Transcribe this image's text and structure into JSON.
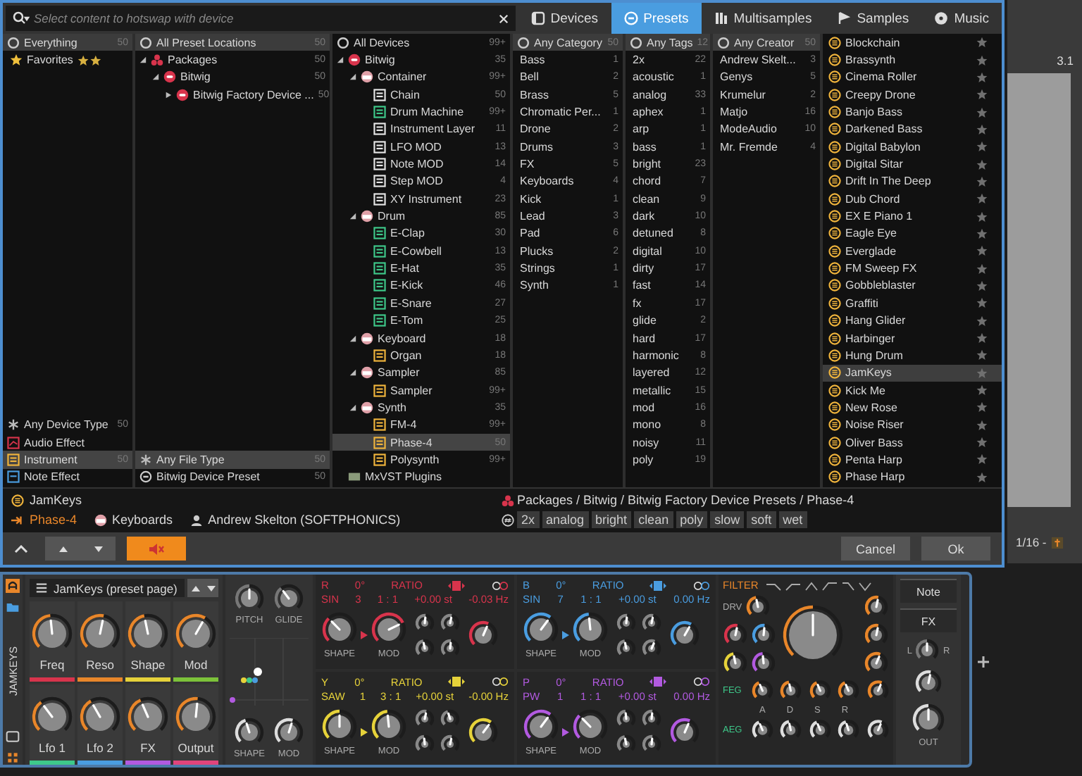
{
  "search": {
    "placeholder": "Select content to hotswap with device"
  },
  "tabs": [
    {
      "label": "Devices",
      "kind": "devices",
      "selected": false
    },
    {
      "label": "Presets",
      "kind": "presets",
      "selected": true
    },
    {
      "label": "Multisamples",
      "kind": "multisamples",
      "selected": false
    },
    {
      "label": "Samples",
      "kind": "samples",
      "selected": false
    },
    {
      "label": "Music",
      "kind": "music",
      "selected": false
    }
  ],
  "sources": {
    "header": {
      "label": "Everything",
      "count": "50",
      "selected": true
    },
    "favorites": {
      "label": "Favorites"
    },
    "device_types": [
      {
        "label": "Any Device Type",
        "count": "50",
        "kind": "any",
        "selected": false
      },
      {
        "label": "Audio Effect",
        "kind": "audio",
        "selected": false
      },
      {
        "label": "Instrument",
        "count": "50",
        "kind": "instrument",
        "selected": true
      },
      {
        "label": "Note Effect",
        "kind": "note",
        "selected": false
      }
    ]
  },
  "locations": {
    "header": {
      "label": "All Preset Locations",
      "count": "50",
      "selected": true
    },
    "tree": [
      {
        "label": "Packages",
        "count": "50",
        "kind": "package",
        "expanded": true,
        "selected": false,
        "children": [
          {
            "label": "Bitwig",
            "count": "50",
            "kind": "creator",
            "expanded": true,
            "selected": false,
            "children": [
              {
                "label": "Bitwig Factory Device ...",
                "count": "50",
                "kind": "creator",
                "expanded": false,
                "selected": false
              }
            ]
          }
        ]
      }
    ],
    "file_types": [
      {
        "label": "Any File Type",
        "count": "50",
        "kind": "any",
        "selected": true
      },
      {
        "label": "Bitwig Device Preset",
        "count": "50",
        "kind": "preset",
        "selected": false
      }
    ]
  },
  "devices": {
    "header": {
      "label": "All Devices",
      "count": "99+",
      "selected": false
    },
    "tree": [
      {
        "label": "Bitwig",
        "count": "35",
        "kind": "creator",
        "expanded": true,
        "selected": false,
        "children": [
          {
            "label": "Container",
            "count": "99+",
            "kind": "group",
            "expanded": true,
            "selected": false,
            "children": [
              {
                "label": "Chain",
                "count": "50",
                "kind": "device",
                "color": "#e6e6e6",
                "selected": false
              },
              {
                "label": "Drum Machine",
                "count": "99+",
                "kind": "device",
                "color": "#3ec98a",
                "selected": false
              },
              {
                "label": "Instrument Layer",
                "count": "11",
                "kind": "device",
                "color": "#e6e6e6",
                "selected": false
              },
              {
                "label": "LFO MOD",
                "count": "13",
                "kind": "device",
                "color": "#e6e6e6",
                "selected": false
              },
              {
                "label": "Note MOD",
                "count": "14",
                "kind": "device",
                "color": "#e6e6e6",
                "selected": false
              },
              {
                "label": "Step MOD",
                "count": "4",
                "kind": "device",
                "color": "#e6e6e6",
                "selected": false
              },
              {
                "label": "XY Instrument",
                "count": "23",
                "kind": "device",
                "color": "#e6e6e6",
                "selected": false
              }
            ]
          },
          {
            "label": "Drum",
            "count": "85",
            "kind": "group",
            "expanded": true,
            "selected": false,
            "children": [
              {
                "label": "E-Clap",
                "count": "30",
                "kind": "device",
                "color": "#3ec98a",
                "selected": false
              },
              {
                "label": "E-Cowbell",
                "count": "13",
                "kind": "device",
                "color": "#3ec98a",
                "selected": false
              },
              {
                "label": "E-Hat",
                "count": "35",
                "kind": "device",
                "color": "#3ec98a",
                "selected": false
              },
              {
                "label": "E-Kick",
                "count": "46",
                "kind": "device",
                "color": "#3ec98a",
                "selected": false
              },
              {
                "label": "E-Snare",
                "count": "27",
                "kind": "device",
                "color": "#3ec98a",
                "selected": false
              },
              {
                "label": "E-Tom",
                "count": "25",
                "kind": "device",
                "color": "#3ec98a",
                "selected": false
              }
            ]
          },
          {
            "label": "Keyboard",
            "count": "18",
            "kind": "group",
            "expanded": true,
            "selected": false,
            "children": [
              {
                "label": "Organ",
                "count": "18",
                "kind": "device",
                "color": "#f0b43c",
                "selected": false
              }
            ]
          },
          {
            "label": "Sampler",
            "count": "85",
            "kind": "group",
            "expanded": true,
            "selected": false,
            "children": [
              {
                "label": "Sampler",
                "count": "99+",
                "kind": "device",
                "color": "#f0b43c",
                "selected": false
              }
            ]
          },
          {
            "label": "Synth",
            "count": "35",
            "kind": "group",
            "expanded": true,
            "selected": false,
            "children": [
              {
                "label": "FM-4",
                "count": "99+",
                "kind": "device",
                "color": "#f0b43c",
                "selected": false
              },
              {
                "label": "Phase-4",
                "count": "50",
                "kind": "device",
                "color": "#f0b43c",
                "selected": true
              },
              {
                "label": "Polysynth",
                "count": "99+",
                "kind": "device",
                "color": "#f0b43c",
                "selected": false
              }
            ]
          }
        ]
      },
      {
        "label": "MxVST Plugins",
        "kind": "plugin",
        "selected": false
      }
    ]
  },
  "categories": {
    "header": {
      "label": "Any Category",
      "count": "50",
      "selected": true
    },
    "items": [
      {
        "label": "Bass",
        "count": "1"
      },
      {
        "label": "Bell",
        "count": "2"
      },
      {
        "label": "Brass",
        "count": "5"
      },
      {
        "label": "Chromatic Per...",
        "count": "1"
      },
      {
        "label": "Drone",
        "count": "2"
      },
      {
        "label": "Drums",
        "count": "3"
      },
      {
        "label": "FX",
        "count": "5"
      },
      {
        "label": "Keyboards",
        "count": "4"
      },
      {
        "label": "Kick",
        "count": "1"
      },
      {
        "label": "Lead",
        "count": "3"
      },
      {
        "label": "Pad",
        "count": "6"
      },
      {
        "label": "Plucks",
        "count": "2"
      },
      {
        "label": "Strings",
        "count": "1"
      },
      {
        "label": "Synth",
        "count": "1"
      }
    ]
  },
  "tags": {
    "header": {
      "label": "Any Tags",
      "count": "12",
      "selected": true
    },
    "items": [
      {
        "label": "2x",
        "count": "22"
      },
      {
        "label": "acoustic",
        "count": "1"
      },
      {
        "label": "analog",
        "count": "33"
      },
      {
        "label": "aphex",
        "count": "1"
      },
      {
        "label": "arp",
        "count": "1"
      },
      {
        "label": "bass",
        "count": "1"
      },
      {
        "label": "bright",
        "count": "23"
      },
      {
        "label": "chord",
        "count": "7"
      },
      {
        "label": "clean",
        "count": "9"
      },
      {
        "label": "dark",
        "count": "10"
      },
      {
        "label": "detuned",
        "count": "8"
      },
      {
        "label": "digital",
        "count": "10"
      },
      {
        "label": "dirty",
        "count": "17"
      },
      {
        "label": "fast",
        "count": "14"
      },
      {
        "label": "fx",
        "count": "17"
      },
      {
        "label": "glide",
        "count": "2"
      },
      {
        "label": "hard",
        "count": "17"
      },
      {
        "label": "harmonic",
        "count": "8"
      },
      {
        "label": "layered",
        "count": "12"
      },
      {
        "label": "metallic",
        "count": "15"
      },
      {
        "label": "mod",
        "count": "16"
      },
      {
        "label": "mono",
        "count": "8"
      },
      {
        "label": "noisy",
        "count": "11"
      },
      {
        "label": "poly",
        "count": "19"
      }
    ]
  },
  "creators": {
    "header": {
      "label": "Any Creator",
      "count": "50",
      "selected": true
    },
    "items": [
      {
        "label": "Andrew Skelt...",
        "count": "3"
      },
      {
        "label": "Genys",
        "count": "5"
      },
      {
        "label": "Krumelur",
        "count": "2"
      },
      {
        "label": "Matjo",
        "count": "16"
      },
      {
        "label": "ModeAudio",
        "count": "10"
      },
      {
        "label": "Mr. Fremde",
        "count": "4"
      }
    ]
  },
  "presets": [
    {
      "label": "Blockchain",
      "favorite": false,
      "selected": false
    },
    {
      "label": "Brassynth",
      "favorite": false,
      "selected": false
    },
    {
      "label": "Cinema Roller",
      "favorite": false,
      "selected": false
    },
    {
      "label": "Creepy Drone",
      "favorite": false,
      "selected": false
    },
    {
      "label": "Banjo Bass",
      "favorite": false,
      "selected": false
    },
    {
      "label": "Darkened Bass",
      "favorite": false,
      "selected": false
    },
    {
      "label": "Digital Babylon",
      "favorite": false,
      "selected": false
    },
    {
      "label": "Digital Sitar",
      "favorite": false,
      "selected": false
    },
    {
      "label": "Drift In The Deep",
      "favorite": false,
      "selected": false
    },
    {
      "label": "Dub Chord",
      "favorite": false,
      "selected": false
    },
    {
      "label": "EX E Piano 1",
      "favorite": false,
      "selected": false
    },
    {
      "label": "Eagle Eye",
      "favorite": false,
      "selected": false
    },
    {
      "label": "Everglade",
      "favorite": false,
      "selected": false
    },
    {
      "label": "FM Sweep FX",
      "favorite": false,
      "selected": false
    },
    {
      "label": "Gobbleblaster",
      "favorite": false,
      "selected": false
    },
    {
      "label": "Graffiti",
      "favorite": false,
      "selected": false
    },
    {
      "label": "Hang Glider",
      "favorite": false,
      "selected": false
    },
    {
      "label": "Harbinger",
      "favorite": false,
      "selected": false
    },
    {
      "label": "Hung Drum",
      "favorite": false,
      "selected": false
    },
    {
      "label": "JamKeys",
      "favorite": false,
      "selected": true
    },
    {
      "label": "Kick Me",
      "favorite": false,
      "selected": false
    },
    {
      "label": "New Rose",
      "favorite": false,
      "selected": false
    },
    {
      "label": "Noise Riser",
      "favorite": false,
      "selected": false
    },
    {
      "label": "Oliver Bass",
      "favorite": false,
      "selected": false
    },
    {
      "label": "Penta Harp",
      "favorite": false,
      "selected": false
    },
    {
      "label": "Phase Harp",
      "favorite": false,
      "selected": false
    }
  ],
  "info": {
    "name": "JamKeys",
    "device": "Phase-4",
    "category": "Keyboards",
    "creator": "Andrew Skelton (SOFTPHONICS)",
    "path": "Packages / Bitwig / Bitwig Factory Device Presets / Phase-4",
    "tags": [
      "2x",
      "analog",
      "bright",
      "clean",
      "poly",
      "slow",
      "soft",
      "wet"
    ]
  },
  "footer": {
    "cancel": "Cancel",
    "ok": "Ok"
  },
  "arranger": {
    "bar": "3.1",
    "grid": "1/16 -"
  },
  "device_panel": {
    "title": "JAMKEYS",
    "page": {
      "title": "JamKeys (preset page)",
      "knobs": [
        {
          "label": "Freq",
          "level": 0.45,
          "color": "#d8344c"
        },
        {
          "label": "Reso",
          "level": 0.6,
          "color": "#e8862a"
        },
        {
          "label": "Shape",
          "level": 0.4,
          "color": "#e6d23a"
        },
        {
          "label": "Mod",
          "level": 0.75,
          "color": "#7cc23a"
        },
        {
          "label": "Lfo 1",
          "level": 0.2,
          "color": "#3ec98a"
        },
        {
          "label": "Lfo 2",
          "level": 0.25,
          "color": "#4a9de0"
        },
        {
          "label": "FX",
          "level": 0.3,
          "color": "#b25ae0"
        },
        {
          "label": "Output",
          "level": 0.55,
          "color": "#e0447c"
        }
      ]
    },
    "pitch": {
      "pitch_label": "PITCH",
      "glide_label": "GLIDE",
      "shape_label": "SHAPE",
      "mod_label": "MOD",
      "knobs": [
        {
          "level": 0.5
        },
        {
          "level": 0.2
        },
        {
          "level": 0.35
        },
        {
          "level": 0.65
        }
      ]
    },
    "operators": [
      {
        "letter": "R",
        "color": "#d8344c",
        "phase": "0°",
        "ratio_label": "RATIO",
        "wave": "SIN",
        "wave_value": "3",
        "ratio": "1 : 1",
        "pitch": "+0.00 st",
        "fine": "-0.03 Hz",
        "shape_label": "SHAPE",
        "mod_label": "MOD",
        "knobs": [
          {
            "level": 0.15
          },
          {
            "level": 0.95
          },
          {
            "level": 0.55
          },
          {
            "level": 0.6
          },
          {
            "level": 0.4
          },
          {
            "level": 0.55
          },
          {
            "level": 0.7
          }
        ]
      },
      {
        "letter": "B",
        "color": "#4a9de0",
        "phase": "0°",
        "ratio_label": "RATIO",
        "wave": "SIN",
        "wave_value": "7",
        "ratio": "1 : 1",
        "pitch": "+0.00 st",
        "fine": "0.00 Hz",
        "shape_label": "SHAPE",
        "mod_label": "MOD",
        "knobs": [
          {
            "level": 0.8
          },
          {
            "level": 0.45
          },
          {
            "level": 0.55
          },
          {
            "level": 0.6
          },
          {
            "level": 0.4
          },
          {
            "level": 0.7
          },
          {
            "level": 0.75
          }
        ]
      },
      {
        "letter": "Y",
        "color": "#e6d23a",
        "phase": "0°",
        "ratio_label": "RATIO",
        "wave": "SAW",
        "wave_value": "1",
        "ratio": "3 : 1",
        "pitch": "+0.00 st",
        "fine": "-0.00 Hz",
        "shape_label": "SHAPE",
        "mod_label": "MOD",
        "knobs": [
          {
            "level": 0.5
          },
          {
            "level": 0.45
          },
          {
            "level": 0.6
          },
          {
            "level": 0.35
          },
          {
            "level": 0.45
          },
          {
            "level": 0.6
          },
          {
            "level": 0.8
          }
        ]
      },
      {
        "letter": "P",
        "color": "#b25ae0",
        "phase": "0°",
        "ratio_label": "RATIO",
        "wave": "PW",
        "wave_value": "1",
        "ratio": "1 : 1",
        "pitch": "+0.00 st",
        "fine": "0.00 Hz",
        "shape_label": "SHAPE",
        "mod_label": "MOD",
        "knobs": [
          {
            "level": 0.8
          },
          {
            "level": 0.15
          },
          {
            "level": 0.45
          },
          {
            "level": 0.55
          },
          {
            "level": 0.4
          },
          {
            "level": 0.55
          },
          {
            "level": 0.7
          }
        ]
      }
    ],
    "filter": {
      "title": "FILTER",
      "drive_label": "DRV",
      "feg_label": "FEG",
      "aeg_label": "AEG",
      "adsr": [
        "A",
        "D",
        "S",
        "R"
      ],
      "knobs": [
        {
          "level": 0.4
        },
        {
          "level": 0.6
        },
        {
          "level": 0.55
        },
        {
          "level": 0.4
        },
        {
          "level": 0.45
        },
        {
          "level": 0.5
        },
        {
          "level": 0.6
        },
        {
          "level": 0.6
        },
        {
          "level": 0.7
        }
      ],
      "feg_knobs": [
        {
          "level": 0.3
        },
        {
          "level": 0.4
        },
        {
          "level": 0.3
        },
        {
          "level": 0.3
        },
        {
          "level": 0.7
        }
      ],
      "aeg_knobs": [
        {
          "level": 0.3
        },
        {
          "level": 0.4
        },
        {
          "level": 0.3
        },
        {
          "level": 0.35
        },
        {
          "level": 0.7
        }
      ]
    },
    "output": {
      "note": "Note",
      "fx": "FX",
      "left": "L",
      "right": "R",
      "out": "OUT",
      "knobs": [
        {
          "level": 0.5
        },
        {
          "level": 0.6
        },
        {
          "level": 0.5
        }
      ]
    }
  }
}
